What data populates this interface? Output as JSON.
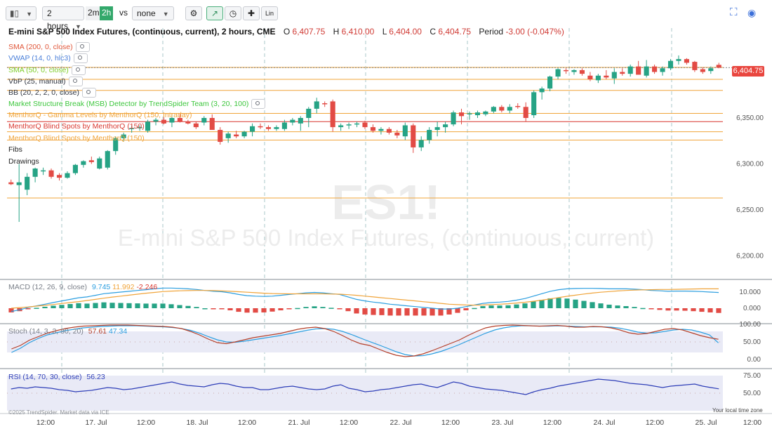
{
  "toolbar": {
    "interval": "2 hours",
    "timeframes": [
      "2m",
      "2h"
    ],
    "active_timeframe": "2h",
    "vs_label": "vs",
    "compare": "none",
    "lin_label": "Lin"
  },
  "header": {
    "title": "E-mini S&P 500 Index Futures, (continuous, current), 2 hours, CME",
    "o_label": "O",
    "o": "6,407.75",
    "h_label": "H",
    "h": "6,410.00",
    "l_label": "L",
    "l": "6,404.00",
    "c_label": "C",
    "c": "6,404.75",
    "period_label": "Period",
    "period": "-3.00 (-0.047%)"
  },
  "indicators": [
    {
      "label": "SMA (200, 0, close)",
      "color": "#e0573a"
    },
    {
      "label": "VWAP (14, 0, hlc3)",
      "color": "#4a7fd9"
    },
    {
      "label": "SMA (50, 0, close)",
      "color": "#7dcc2a"
    },
    {
      "label": "VbP (25, manual)",
      "color": "#2e3440"
    },
    {
      "label": "BB (20, 2, 2, 0, close)",
      "color": "#2e3440"
    },
    {
      "label": "Market Structure Break (MSB) Detector by TrendSpider Team (3, 20, 100)",
      "color": "#3cc63c"
    },
    {
      "label": "MenthorQ - Gamma Levels by MenthorQ (150, Intraday)",
      "color": "#f0a43a"
    },
    {
      "label": "MenthorQ Blind Spots by MenthorQ (150)",
      "color": "#d9372f"
    },
    {
      "label": "MenthorQ Blind Spots by MenthorQ (150)",
      "color": "#f0a43a"
    },
    {
      "label": "Fibs",
      "color": "#222222"
    },
    {
      "label": "Drawings",
      "color": "#222222"
    }
  ],
  "watermark": {
    "symbol": "ES1!",
    "name": "E-mini S&P 500 Index Futures, (continuous, current)"
  },
  "last_price_tag": "6,404.75",
  "macd": {
    "label": "MACD (12, 26, 9, close)",
    "v1": "9.745",
    "v2": "11.992",
    "v3": "-2.246",
    "c1": "#2b9ee0",
    "c2": "#f0a43a",
    "c3": "#d9372f"
  },
  "stoch": {
    "label": "Stoch (14, 3, 3, 80, 20)",
    "v1": "57.61",
    "v2": "47.34",
    "c1": "#b5402a",
    "c2": "#2b9ee0"
  },
  "rsi": {
    "label": "RSI (14, 70, 30, close)",
    "v1": "56.23",
    "c1": "#2f3fb8"
  },
  "footer": {
    "copyright": "©2025 TrendSpider. Market data via ICE",
    "timezone": "Your local time zone"
  },
  "chart_data": {
    "type": "candlestick",
    "price_axis_ticks": [
      "6,350.00",
      "6,300.00",
      "6,250.00",
      "6,200.00"
    ],
    "price_axis_values": [
      6350,
      6300,
      6250,
      6200
    ],
    "ylim": [
      6180,
      6430
    ],
    "macd_axis_ticks": [
      "10.000",
      "0.000"
    ],
    "stoch_axis_ticks": [
      "100.00",
      "50.00",
      "0.00"
    ],
    "rsi_axis_ticks": [
      "75.00",
      "50.00"
    ],
    "x_ticks": [
      "12:00",
      "17. Jul",
      "12:00",
      "18. Jul",
      "12:00",
      "21. Jul",
      "12:00",
      "22. Jul",
      "12:00",
      "23. Jul",
      "12:00",
      "24. Jul",
      "12:00",
      "25. Jul",
      "12:00"
    ],
    "horizontal_levels": [
      {
        "price": 6405,
        "color": "#f0a43a"
      },
      {
        "price": 6392,
        "color": "#f0a43a"
      },
      {
        "price": 6380,
        "color": "#f0a43a"
      },
      {
        "price": 6355,
        "color": "#f0a43a"
      },
      {
        "price": 6346,
        "color": "#d9372f"
      },
      {
        "price": 6335,
        "color": "#f0a43a"
      },
      {
        "price": 6326,
        "color": "#f0a43a"
      },
      {
        "price": 6263,
        "color": "#f0a43a"
      }
    ],
    "candles": [
      {
        "o": 6280,
        "h": 6283,
        "l": 6277,
        "c": 6278
      },
      {
        "o": 6277,
        "h": 6300,
        "l": 6237,
        "c": 6280
      },
      {
        "o": 6272,
        "h": 6290,
        "l": 6266,
        "c": 6286
      },
      {
        "o": 6286,
        "h": 6296,
        "l": 6280,
        "c": 6295
      },
      {
        "o": 6292,
        "h": 6296,
        "l": 6288,
        "c": 6293
      },
      {
        "o": 6293,
        "h": 6295,
        "l": 6284,
        "c": 6286
      },
      {
        "o": 6288,
        "h": 6290,
        "l": 6282,
        "c": 6285
      },
      {
        "o": 6285,
        "h": 6292,
        "l": 6284,
        "c": 6290
      },
      {
        "o": 6290,
        "h": 6300,
        "l": 6288,
        "c": 6299
      },
      {
        "o": 6299,
        "h": 6304,
        "l": 6296,
        "c": 6303
      },
      {
        "o": 6304,
        "h": 6308,
        "l": 6300,
        "c": 6302
      },
      {
        "o": 6295,
        "h": 6308,
        "l": 6294,
        "c": 6306
      },
      {
        "o": 6296,
        "h": 6315,
        "l": 6294,
        "c": 6314
      },
      {
        "o": 6314,
        "h": 6330,
        "l": 6310,
        "c": 6328
      },
      {
        "o": 6328,
        "h": 6334,
        "l": 6325,
        "c": 6332
      },
      {
        "o": 6338,
        "h": 6342,
        "l": 6334,
        "c": 6339
      },
      {
        "o": 6339,
        "h": 6342,
        "l": 6336,
        "c": 6340
      },
      {
        "o": 6336,
        "h": 6348,
        "l": 6334,
        "c": 6346
      },
      {
        "o": 6346,
        "h": 6350,
        "l": 6342,
        "c": 6348
      },
      {
        "o": 6348,
        "h": 6352,
        "l": 6343,
        "c": 6344
      },
      {
        "o": 6345,
        "h": 6353,
        "l": 6340,
        "c": 6350
      },
      {
        "o": 6350,
        "h": 6354,
        "l": 6345,
        "c": 6346
      },
      {
        "o": 6346,
        "h": 6348,
        "l": 6343,
        "c": 6344
      },
      {
        "o": 6344,
        "h": 6346,
        "l": 6338,
        "c": 6340
      },
      {
        "o": 6345,
        "h": 6352,
        "l": 6342,
        "c": 6350
      },
      {
        "o": 6350,
        "h": 6354,
        "l": 6344,
        "c": 6337
      },
      {
        "o": 6337,
        "h": 6340,
        "l": 6321,
        "c": 6324
      },
      {
        "o": 6328,
        "h": 6335,
        "l": 6323,
        "c": 6333
      },
      {
        "o": 6332,
        "h": 6336,
        "l": 6328,
        "c": 6330
      },
      {
        "o": 6330,
        "h": 6336,
        "l": 6328,
        "c": 6335
      },
      {
        "o": 6335,
        "h": 6344,
        "l": 6330,
        "c": 6341
      },
      {
        "o": 6341,
        "h": 6344,
        "l": 6338,
        "c": 6340
      },
      {
        "o": 6340,
        "h": 6342,
        "l": 6336,
        "c": 6338
      },
      {
        "o": 6338,
        "h": 6342,
        "l": 6336,
        "c": 6340
      },
      {
        "o": 6338,
        "h": 6348,
        "l": 6336,
        "c": 6345
      },
      {
        "o": 6345,
        "h": 6350,
        "l": 6342,
        "c": 6348
      },
      {
        "o": 6344,
        "h": 6352,
        "l": 6336,
        "c": 6350
      },
      {
        "o": 6350,
        "h": 6362,
        "l": 6340,
        "c": 6360
      },
      {
        "o": 6360,
        "h": 6372,
        "l": 6355,
        "c": 6368
      },
      {
        "o": 6366,
        "h": 6368,
        "l": 6362,
        "c": 6365
      },
      {
        "o": 6368,
        "h": 6370,
        "l": 6335,
        "c": 6340
      },
      {
        "o": 6340,
        "h": 6344,
        "l": 6336,
        "c": 6342
      },
      {
        "o": 6342,
        "h": 6345,
        "l": 6338,
        "c": 6343
      },
      {
        "o": 6343,
        "h": 6346,
        "l": 6340,
        "c": 6344
      },
      {
        "o": 6345,
        "h": 6347,
        "l": 6338,
        "c": 6340
      },
      {
        "o": 6340,
        "h": 6343,
        "l": 6334,
        "c": 6336
      },
      {
        "o": 6336,
        "h": 6340,
        "l": 6332,
        "c": 6338
      },
      {
        "o": 6338,
        "h": 6340,
        "l": 6332,
        "c": 6334
      },
      {
        "o": 6334,
        "h": 6337,
        "l": 6328,
        "c": 6331
      },
      {
        "o": 6330,
        "h": 6345,
        "l": 6326,
        "c": 6342
      },
      {
        "o": 6342,
        "h": 6344,
        "l": 6312,
        "c": 6318
      },
      {
        "o": 6318,
        "h": 6330,
        "l": 6314,
        "c": 6326
      },
      {
        "o": 6326,
        "h": 6340,
        "l": 6322,
        "c": 6337
      },
      {
        "o": 6337,
        "h": 6346,
        "l": 6330,
        "c": 6340
      },
      {
        "o": 6340,
        "h": 6346,
        "l": 6334,
        "c": 6343
      },
      {
        "o": 6343,
        "h": 6358,
        "l": 6341,
        "c": 6356
      },
      {
        "o": 6356,
        "h": 6360,
        "l": 6343,
        "c": 6352
      },
      {
        "o": 6354,
        "h": 6357,
        "l": 6348,
        "c": 6355
      },
      {
        "o": 6353,
        "h": 6358,
        "l": 6350,
        "c": 6356
      },
      {
        "o": 6354,
        "h": 6358,
        "l": 6352,
        "c": 6357
      },
      {
        "o": 6357,
        "h": 6363,
        "l": 6355,
        "c": 6362
      },
      {
        "o": 6362,
        "h": 6364,
        "l": 6356,
        "c": 6358
      },
      {
        "o": 6358,
        "h": 6365,
        "l": 6355,
        "c": 6362
      },
      {
        "o": 6363,
        "h": 6366,
        "l": 6360,
        "c": 6362
      },
      {
        "o": 6362,
        "h": 6367,
        "l": 6346,
        "c": 6350
      },
      {
        "o": 6353,
        "h": 6380,
        "l": 6350,
        "c": 6378
      },
      {
        "o": 6378,
        "h": 6384,
        "l": 6370,
        "c": 6382
      },
      {
        "o": 6382,
        "h": 6396,
        "l": 6379,
        "c": 6395
      },
      {
        "o": 6395,
        "h": 6404,
        "l": 6392,
        "c": 6403
      },
      {
        "o": 6402,
        "h": 6404,
        "l": 6398,
        "c": 6401
      },
      {
        "o": 6400,
        "h": 6403,
        "l": 6397,
        "c": 6402
      },
      {
        "o": 6402,
        "h": 6404,
        "l": 6396,
        "c": 6398
      },
      {
        "o": 6396,
        "h": 6400,
        "l": 6390,
        "c": 6392
      },
      {
        "o": 6391,
        "h": 6398,
        "l": 6388,
        "c": 6396
      },
      {
        "o": 6396,
        "h": 6402,
        "l": 6392,
        "c": 6394
      },
      {
        "o": 6393,
        "h": 6404,
        "l": 6387,
        "c": 6400
      },
      {
        "o": 6400,
        "h": 6404,
        "l": 6396,
        "c": 6398
      },
      {
        "o": 6398,
        "h": 6408,
        "l": 6395,
        "c": 6406
      },
      {
        "o": 6406,
        "h": 6412,
        "l": 6398,
        "c": 6397
      },
      {
        "o": 6396,
        "h": 6413,
        "l": 6394,
        "c": 6406
      },
      {
        "o": 6406,
        "h": 6408,
        "l": 6398,
        "c": 6400
      },
      {
        "o": 6400,
        "h": 6406,
        "l": 6396,
        "c": 6404
      },
      {
        "o": 6404,
        "h": 6414,
        "l": 6402,
        "c": 6412
      },
      {
        "o": 6412,
        "h": 6418,
        "l": 6408,
        "c": 6414
      },
      {
        "o": 6414,
        "h": 6415,
        "l": 6408,
        "c": 6410
      },
      {
        "o": 6411,
        "h": 6412,
        "l": 6400,
        "c": 6402
      },
      {
        "o": 6403,
        "h": 6405,
        "l": 6398,
        "c": 6400
      },
      {
        "o": 6401,
        "h": 6406,
        "l": 6398,
        "c": 6404
      },
      {
        "o": 6407.75,
        "h": 6410,
        "l": 6404,
        "c": 6404.75
      }
    ],
    "macd_line": [
      -2,
      -1,
      0.5,
      1.5,
      2.5,
      3.5,
      4.5,
      5.5,
      6.5,
      7,
      8,
      9,
      9.5,
      10,
      10.5,
      11,
      11.5,
      12,
      12.5,
      12.5,
      12.3,
      12,
      11.6,
      11,
      10.5,
      10.2,
      9.5,
      8.5,
      7.8,
      7.5,
      7.3,
      7.5,
      8,
      8.5,
      9,
      9.5,
      9.8,
      9.5,
      9,
      8.5,
      7,
      5.5,
      4.5,
      3.8,
      3.2,
      2.5,
      2,
      1.5,
      1,
      0.5,
      0,
      -0.5,
      -0.5,
      0,
      1,
      2,
      3,
      3.5,
      3.8,
      4.2,
      5,
      6,
      7.5,
      9,
      10.5,
      11.5,
      12,
      12.2,
      12.3,
      12.3,
      12.2,
      12,
      12,
      12,
      11.8,
      11.5,
      11,
      10.8,
      10.5,
      10.6,
      10.6,
      10.5,
      10.3,
      10,
      9.745
    ],
    "macd_signal": [
      0,
      0.4,
      0.8,
      1.3,
      1.8,
      2.3,
      2.9,
      3.5,
      4.1,
      4.8,
      5.5,
      6.2,
      6.9,
      7.5,
      8.1,
      8.7,
      9.3,
      9.8,
      10.3,
      10.6,
      10.8,
      10.9,
      11,
      11,
      10.9,
      10.7,
      10.5,
      10.2,
      9.9,
      9.6,
      9.3,
      9.1,
      9,
      8.9,
      8.9,
      8.9,
      8.9,
      8.9,
      8.8,
      8.7,
      8.4,
      8,
      7.5,
      7,
      6.5,
      6,
      5.5,
      5,
      4.5,
      4,
      3.5,
      3,
      2.5,
      2.2,
      2,
      1.9,
      2,
      2.2,
      2.5,
      2.8,
      3.2,
      3.7,
      4.3,
      5,
      5.8,
      6.6,
      7.4,
      8.1,
      8.8,
      9.4,
      9.9,
      10.3,
      10.7,
      11,
      11.2,
      11.4,
      11.5,
      11.6,
      11.6,
      11.7,
      11.8,
      11.9,
      12,
      12,
      11.992
    ],
    "stoch_k": [
      30,
      40,
      55,
      65,
      75,
      82,
      88,
      92,
      95,
      96,
      97,
      98,
      98,
      98,
      97,
      96,
      95,
      94,
      92,
      88,
      80,
      70,
      58,
      48,
      45,
      50,
      56,
      62,
      66,
      70,
      74,
      80,
      86,
      90,
      92,
      88,
      80,
      68,
      55,
      45,
      40,
      30,
      20,
      12,
      8,
      10,
      16,
      25,
      35,
      45,
      55,
      68,
      80,
      90,
      95,
      97,
      98,
      97,
      96,
      95,
      96,
      97,
      95,
      92,
      92,
      94,
      93,
      90,
      84,
      76,
      72,
      74,
      80,
      86,
      88,
      84,
      76,
      68,
      62,
      57.61
    ],
    "stoch_d": [
      20,
      32,
      48,
      60,
      70,
      76,
      82,
      86,
      90,
      92,
      94,
      95,
      96,
      96,
      96,
      95,
      94,
      93,
      91,
      88,
      83,
      75,
      65,
      56,
      50,
      49,
      52,
      56,
      60,
      64,
      68,
      73,
      78,
      83,
      87,
      88,
      86,
      80,
      71,
      61,
      51,
      42,
      32,
      22,
      14,
      10,
      11,
      16,
      23,
      32,
      42,
      53,
      64,
      75,
      84,
      90,
      94,
      96,
      96,
      95,
      95,
      96,
      95,
      94,
      93,
      93,
      93,
      92,
      89,
      84,
      78,
      75,
      76,
      80,
      84,
      86,
      84,
      78,
      70,
      47.34
    ],
    "rsi": [
      56,
      58,
      57,
      59,
      58,
      57,
      55,
      54,
      52,
      53,
      54,
      56,
      58,
      57,
      55,
      56,
      58,
      60,
      62,
      64,
      66,
      63,
      61,
      60,
      59,
      62,
      64,
      63,
      60,
      58,
      58,
      55,
      55,
      57,
      59,
      60,
      58,
      56,
      55,
      56,
      60,
      62,
      57,
      55,
      52,
      53,
      55,
      56,
      58,
      60,
      62,
      63,
      60,
      58,
      62,
      66,
      64,
      60,
      58,
      56,
      55,
      54,
      52,
      50,
      48,
      52,
      55,
      57,
      60,
      62,
      64,
      66,
      68,
      70,
      69,
      68,
      66,
      64,
      63,
      62,
      60,
      58,
      60,
      61,
      62,
      63,
      60,
      58,
      56.23
    ]
  }
}
